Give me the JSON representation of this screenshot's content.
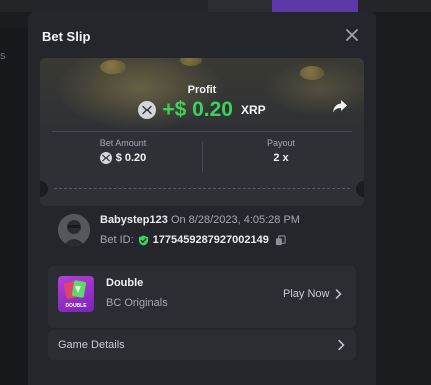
{
  "modal": {
    "title": "Bet Slip"
  },
  "ticket": {
    "profit_label": "Profit",
    "profit_amount": "+$ 0.20",
    "profit_currency": "XRP",
    "bet_amount_label": "Bet Amount",
    "bet_amount_value": "$ 0.20",
    "payout_label": "Payout",
    "payout_value": "2 x"
  },
  "bettor": {
    "username": "Babystep123",
    "timestamp": "On 8/28/2023, 4:05:28 PM",
    "bet_id_label": "Bet ID:",
    "bet_id_value": "1775459287927002149"
  },
  "game": {
    "name": "Double",
    "provider": "BC Originals",
    "thumb_text": "DOUBLE",
    "play_label": "Play Now"
  },
  "details": {
    "label": "Game Details"
  },
  "background": {
    "left_text": "s"
  },
  "colors": {
    "profit_green": "#3bd15a",
    "accent_purple": "#5b3aa8",
    "panel": "#24262b"
  },
  "icons": {
    "close": "close-icon",
    "share": "share-icon",
    "currency": "xrp-icon",
    "verified": "shield-check-icon",
    "copy": "copy-icon",
    "chevron": "chevron-right-icon"
  }
}
